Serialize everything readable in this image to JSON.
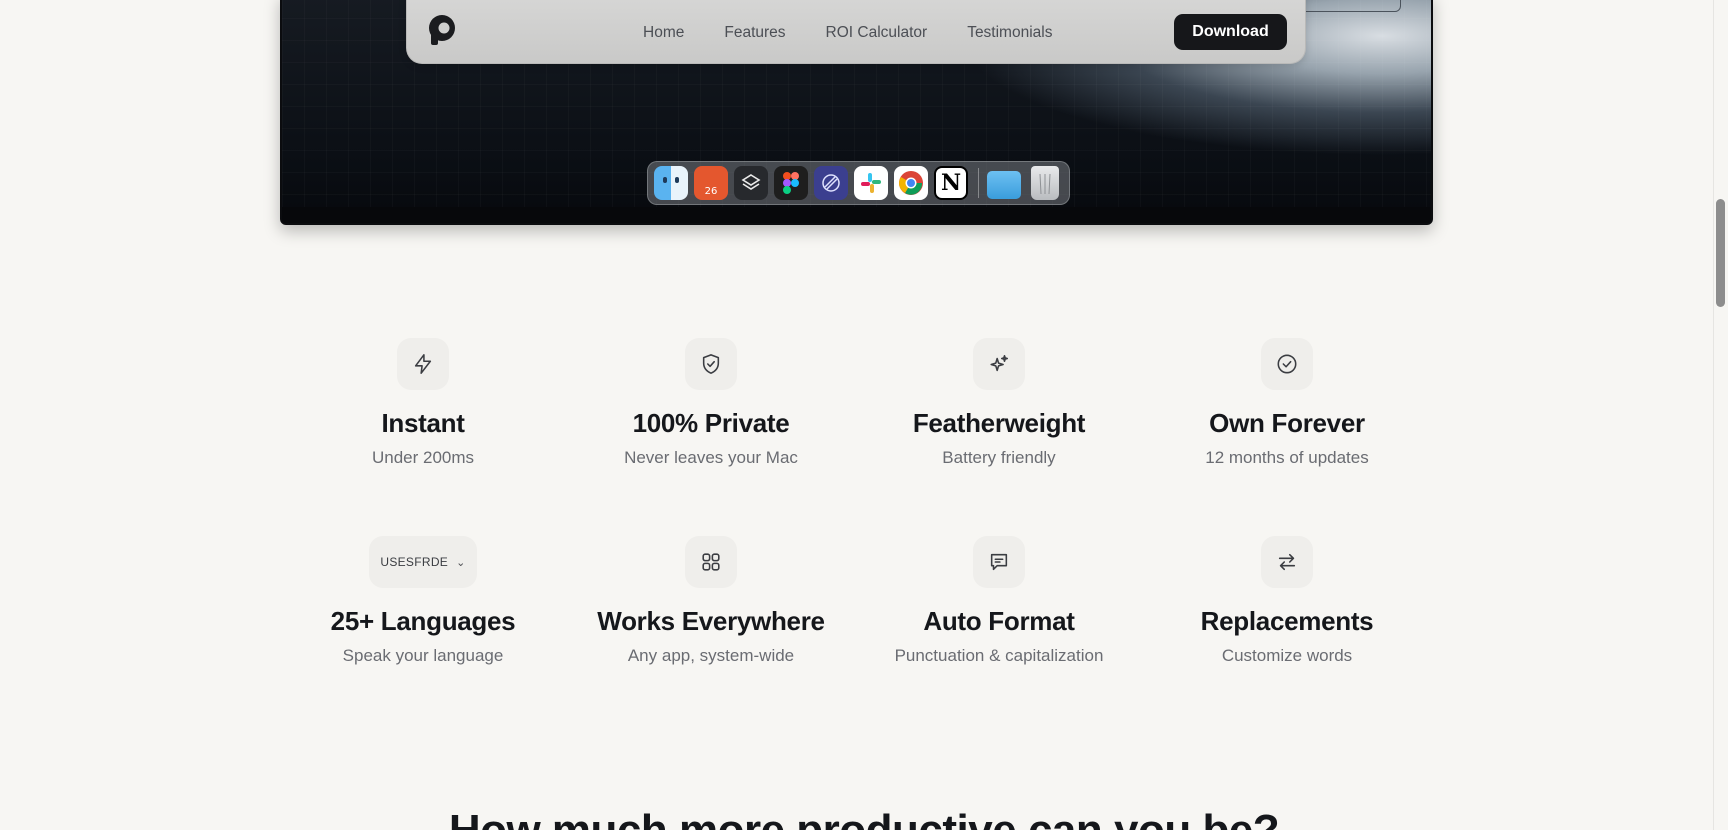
{
  "nav": {
    "links": [
      "Home",
      "Features",
      "ROI Calculator",
      "Testimonials"
    ],
    "download_label": "Download"
  },
  "dock": {
    "calendar_date": "26",
    "notion_letter": "N",
    "apps": [
      "finder-icon",
      "calendar-icon",
      "layers-icon",
      "figma-icon",
      "linear-icon",
      "slack-icon",
      "chrome-icon",
      "notion-icon",
      "folder-icon",
      "trash-icon"
    ]
  },
  "features": [
    {
      "title": "Instant",
      "subtitle": "Under 200ms",
      "icon": "lightning-icon"
    },
    {
      "title": "100% Private",
      "subtitle": "Never leaves your Mac",
      "icon": "shield-check-icon"
    },
    {
      "title": "Featherweight",
      "subtitle": "Battery friendly",
      "icon": "sparkles-icon"
    },
    {
      "title": "Own Forever",
      "subtitle": "12 months of updates",
      "icon": "check-circle-icon"
    },
    {
      "title": "25+ Languages",
      "subtitle": "Speak your language",
      "icon": "language-selector",
      "pill_text": "USESFRDE"
    },
    {
      "title": "Works Everywhere",
      "subtitle": "Any app, system-wide",
      "icon": "grid-icon"
    },
    {
      "title": "Auto Format",
      "subtitle": "Punctuation & capitalization",
      "icon": "message-icon"
    },
    {
      "title": "Replacements",
      "subtitle": "Customize words",
      "icon": "arrows-swap-icon"
    }
  ],
  "section": {
    "heading": "How much more productive can you be?"
  },
  "colors": {
    "background": "#f7f6f3",
    "text": "#15171b",
    "muted": "#6a6c72",
    "icon_bg": "#efeeeb",
    "button": "#16171a"
  }
}
